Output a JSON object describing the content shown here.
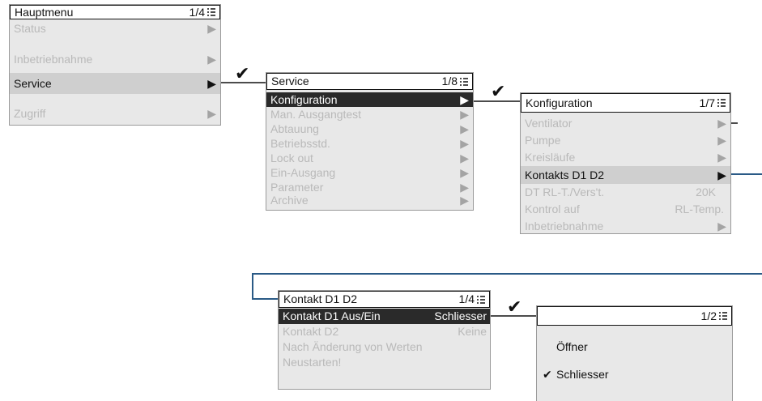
{
  "hauptmenu": {
    "title": "Hauptmenu",
    "page": "1/4",
    "items": [
      {
        "label": "Status"
      },
      {
        "label": "Inbetriebnahme"
      },
      {
        "label": "Service"
      },
      {
        "label": "Zugriff"
      }
    ]
  },
  "service": {
    "title": "Service",
    "page": "1/8",
    "items": [
      {
        "label": "Konfiguration"
      },
      {
        "label": "Man. Ausgangtest"
      },
      {
        "label": "Abtauung"
      },
      {
        "label": "Betriebsstd."
      },
      {
        "label": "Lock out"
      },
      {
        "label": "Ein-Ausgang"
      },
      {
        "label": "Parameter"
      },
      {
        "label": "Archive"
      }
    ]
  },
  "konfiguration": {
    "title": "Konfiguration",
    "page": "1/7",
    "items": [
      {
        "label": "Ventilator"
      },
      {
        "label": "Pumpe"
      },
      {
        "label": "Kreisläufe"
      },
      {
        "label": "Kontakts D1 D2"
      },
      {
        "label": "DT RL-T./Vers't.",
        "value": "20K"
      },
      {
        "label": "Kontrol auf",
        "value": "RL-Temp."
      },
      {
        "label": "Inbetriebnahme"
      }
    ]
  },
  "kontakt": {
    "title": "Kontakt D1 D2",
    "page": "1/4",
    "items": [
      {
        "label": "Kontakt D1 Aus/Ein",
        "value": "Schliesser"
      },
      {
        "label": "Kontakt D2",
        "value": "Keine"
      },
      {
        "label": "Nach Änderung von Werten"
      },
      {
        "label": "Neustarten!"
      }
    ]
  },
  "auswahl": {
    "page": "1/2",
    "options": [
      {
        "label": "Öffner"
      },
      {
        "label": "Schliesser"
      }
    ]
  },
  "colors": {
    "connector_blue": "#2a5a86",
    "selected_row": "#cfcfcf",
    "dark_row": "#2a2a2a"
  },
  "icons": {
    "check": "checkmark-icon",
    "arrow": "triangle-right-icon",
    "page": "menu-list-icon"
  }
}
